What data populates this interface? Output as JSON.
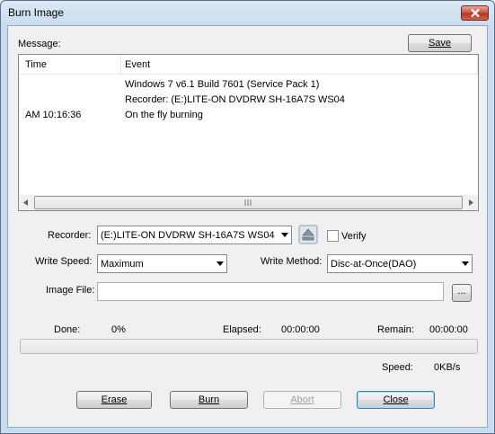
{
  "window": {
    "title": "Burn Image"
  },
  "message_label": "Message:",
  "save_label": "Save",
  "log": {
    "columns": [
      "Time",
      "Event"
    ],
    "rows": [
      {
        "time": "",
        "event": "Windows 7 v6.1 Build 7601 (Service Pack 1)"
      },
      {
        "time": "",
        "event": "Recorder: (E:)LITE-ON DVDRW SH-16A7S  WS04"
      },
      {
        "time": "AM 10:16:36",
        "event": "On the fly burning"
      }
    ]
  },
  "recorder": {
    "label": "Recorder:",
    "value": "(E:)LITE-ON DVDRW SH-16A7S  WS04",
    "verify_label": "Verify",
    "verify_checked": false
  },
  "write_speed": {
    "label": "Write Speed:",
    "value": "Maximum"
  },
  "write_method": {
    "label": "Write Method:",
    "value": "Disc-at-Once(DAO)"
  },
  "image_file": {
    "label": "Image File:",
    "value": "",
    "browse_label": "..."
  },
  "status": {
    "done_label": "Done:",
    "done_value": "0%",
    "elapsed_label": "Elapsed:",
    "elapsed_value": "00:00:00",
    "remain_label": "Remain:",
    "remain_value": "00:00:00",
    "speed_label": "Speed:",
    "speed_value": "0KB/s",
    "progress": 0
  },
  "buttons": {
    "erase": "Erase",
    "burn": "Burn",
    "abort": "Abort",
    "close": "Close"
  },
  "icons": {
    "close": "close-icon",
    "eject": "eject-icon"
  }
}
